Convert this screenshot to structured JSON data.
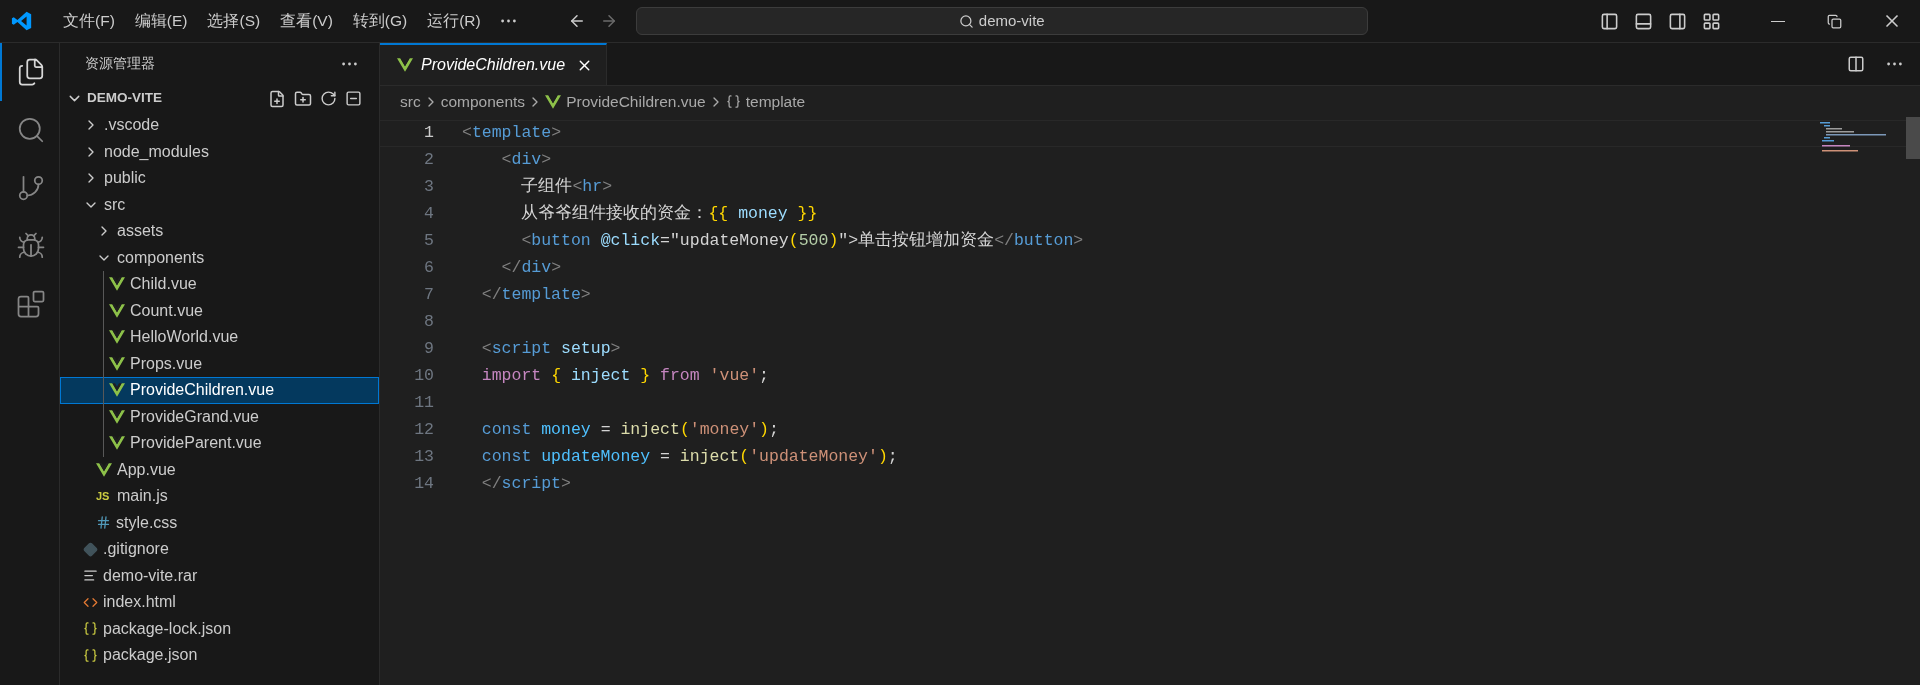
{
  "title_bar": {
    "menu": [
      "文件(F)",
      "编辑(E)",
      "选择(S)",
      "查看(V)",
      "转到(G)",
      "运行(R)"
    ],
    "search": "demo-vite"
  },
  "activity_bar": [
    {
      "kind": "explorer",
      "selected": true
    },
    {
      "kind": "search",
      "selected": false
    },
    {
      "kind": "source_control",
      "selected": false
    },
    {
      "kind": "run_debug",
      "selected": false
    },
    {
      "kind": "extensions",
      "selected": false
    }
  ],
  "sidebar": {
    "title": "资源管理器",
    "root": {
      "label": "DEMO-VITE",
      "expanded": true
    },
    "tree": [
      {
        "label": ".vscode",
        "kind": "folder",
        "expanded": false,
        "selected": false
      },
      {
        "label": "node_modules",
        "kind": "folder",
        "expanded": false,
        "selected": false
      },
      {
        "label": "public",
        "kind": "folder",
        "expanded": false,
        "selected": false
      },
      {
        "label": "src",
        "kind": "folder",
        "expanded": true,
        "selected": false,
        "children": [
          {
            "label": "assets",
            "kind": "folder",
            "expanded": false,
            "selected": false
          },
          {
            "label": "components",
            "kind": "folder",
            "expanded": true,
            "selected": false,
            "children": [
              {
                "label": "Child.vue",
                "kind": "vue",
                "selected": false
              },
              {
                "label": "Count.vue",
                "kind": "vue",
                "selected": false
              },
              {
                "label": "HelloWorld.vue",
                "kind": "vue",
                "selected": false
              },
              {
                "label": "Props.vue",
                "kind": "vue",
                "selected": false
              },
              {
                "label": "ProvideChildren.vue",
                "kind": "vue",
                "selected": true
              },
              {
                "label": "ProvideGrand.vue",
                "kind": "vue",
                "selected": false
              },
              {
                "label": "ProvideParent.vue",
                "kind": "vue",
                "selected": false
              }
            ]
          },
          {
            "label": "App.vue",
            "kind": "vue",
            "selected": false
          },
          {
            "label": "main.js",
            "kind": "js",
            "icon_label": "JS",
            "selected": false
          },
          {
            "label": "style.css",
            "kind": "css",
            "selected": false
          }
        ]
      },
      {
        "label": ".gitignore",
        "kind": "git",
        "selected": false
      },
      {
        "label": "demo-vite.rar",
        "kind": "text",
        "selected": false
      },
      {
        "label": "index.html",
        "kind": "html",
        "selected": false
      },
      {
        "label": "package-lock.json",
        "kind": "json",
        "selected": false
      },
      {
        "label": "package.json",
        "kind": "json",
        "selected": false
      }
    ]
  },
  "editor": {
    "tabs": [
      {
        "label": "ProvideChildren.vue",
        "selected": true,
        "preview": true
      }
    ],
    "breadcrumbs": [
      {
        "label": "src",
        "kind": "folder"
      },
      {
        "label": "components",
        "kind": "folder"
      },
      {
        "label": "ProvideChildren.vue",
        "kind": "vue"
      },
      {
        "label": "template",
        "kind": "symbol"
      }
    ],
    "lines": [
      {
        "number": "1",
        "selected": true,
        "tokens": [
          {
            "text": "<",
            "kind": "punct"
          },
          {
            "text": "template",
            "kind": "tag"
          },
          {
            "text": ">",
            "kind": "punct"
          }
        ]
      },
      {
        "number": "2",
        "selected": false,
        "tokens": [
          {
            "text": "    <",
            "kind": "punct"
          },
          {
            "text": "div",
            "kind": "tag"
          },
          {
            "text": ">",
            "kind": "punct"
          }
        ]
      },
      {
        "number": "3",
        "selected": false,
        "tokens": [
          {
            "text": "      子组件",
            "kind": "plain"
          },
          {
            "text": "<",
            "kind": "punct"
          },
          {
            "text": "hr",
            "kind": "tag"
          },
          {
            "text": ">",
            "kind": "punct"
          }
        ]
      },
      {
        "number": "4",
        "selected": false,
        "tokens": [
          {
            "text": "      从爷爷组件接收的资金：",
            "kind": "plain"
          },
          {
            "text": "{{",
            "kind": "bracket"
          },
          {
            "text": " money ",
            "kind": "attr"
          },
          {
            "text": "}}",
            "kind": "bracket"
          }
        ]
      },
      {
        "number": "5",
        "selected": false,
        "tokens": [
          {
            "text": "      <",
            "kind": "punct"
          },
          {
            "text": "button",
            "kind": "tag"
          },
          {
            "text": " @click",
            "kind": "attr"
          },
          {
            "text": "=\"updateMoney",
            "kind": "plain"
          },
          {
            "text": "(",
            "kind": "bracket"
          },
          {
            "text": "500",
            "kind": "number"
          },
          {
            "text": ")",
            "kind": "bracket"
          },
          {
            "text": "\">单击按钮增加资金",
            "kind": "plain"
          },
          {
            "text": "</",
            "kind": "punct"
          },
          {
            "text": "button",
            "kind": "tag"
          },
          {
            "text": ">",
            "kind": "punct"
          }
        ]
      },
      {
        "number": "6",
        "selected": false,
        "tokens": [
          {
            "text": "    </",
            "kind": "punct"
          },
          {
            "text": "div",
            "kind": "tag"
          },
          {
            "text": ">",
            "kind": "punct"
          }
        ]
      },
      {
        "number": "7",
        "selected": false,
        "tokens": [
          {
            "text": "  </",
            "kind": "punct"
          },
          {
            "text": "template",
            "kind": "tag"
          },
          {
            "text": ">",
            "kind": "punct"
          }
        ]
      },
      {
        "number": "8",
        "selected": false
      },
      {
        "number": "9",
        "selected": false,
        "tokens": [
          {
            "text": "  <",
            "kind": "punct"
          },
          {
            "text": "script",
            "kind": "tag"
          },
          {
            "text": " setup",
            "kind": "attr"
          },
          {
            "text": ">",
            "kind": "punct"
          }
        ]
      },
      {
        "number": "10",
        "selected": false,
        "tokens": [
          {
            "text": "  import ",
            "kind": "keyword"
          },
          {
            "text": "{",
            "kind": "bracket"
          },
          {
            "text": " inject ",
            "kind": "attr"
          },
          {
            "text": "}",
            "kind": "bracket"
          },
          {
            "text": " from ",
            "kind": "keyword"
          },
          {
            "text": "'vue'",
            "kind": "string"
          },
          {
            "text": ";",
            "kind": "plain"
          }
        ]
      },
      {
        "number": "11",
        "selected": false
      },
      {
        "number": "12",
        "selected": false,
        "tokens": [
          {
            "text": "  const",
            "kind": "storage"
          },
          {
            "text": " money",
            "kind": "var"
          },
          {
            "text": " = ",
            "kind": "plain"
          },
          {
            "text": "inject",
            "kind": "func"
          },
          {
            "text": "(",
            "kind": "bracket"
          },
          {
            "text": "'money'",
            "kind": "string"
          },
          {
            "text": ")",
            "kind": "bracket"
          },
          {
            "text": ";",
            "kind": "plain"
          }
        ]
      },
      {
        "number": "13",
        "selected": false,
        "tokens": [
          {
            "text": "  const",
            "kind": "storage"
          },
          {
            "text": " updateMoney",
            "kind": "var"
          },
          {
            "text": " = ",
            "kind": "plain"
          },
          {
            "text": "inject",
            "kind": "func"
          },
          {
            "text": "(",
            "kind": "bracket"
          },
          {
            "text": "'updateMoney'",
            "kind": "string"
          },
          {
            "text": ")",
            "kind": "bracket"
          },
          {
            "text": ";",
            "kind": "plain"
          }
        ]
      },
      {
        "number": "14",
        "selected": false,
        "tokens": [
          {
            "text": "  </",
            "kind": "punct"
          },
          {
            "text": "script",
            "kind": "tag"
          },
          {
            "text": ">",
            "kind": "punct"
          }
        ]
      }
    ]
  }
}
